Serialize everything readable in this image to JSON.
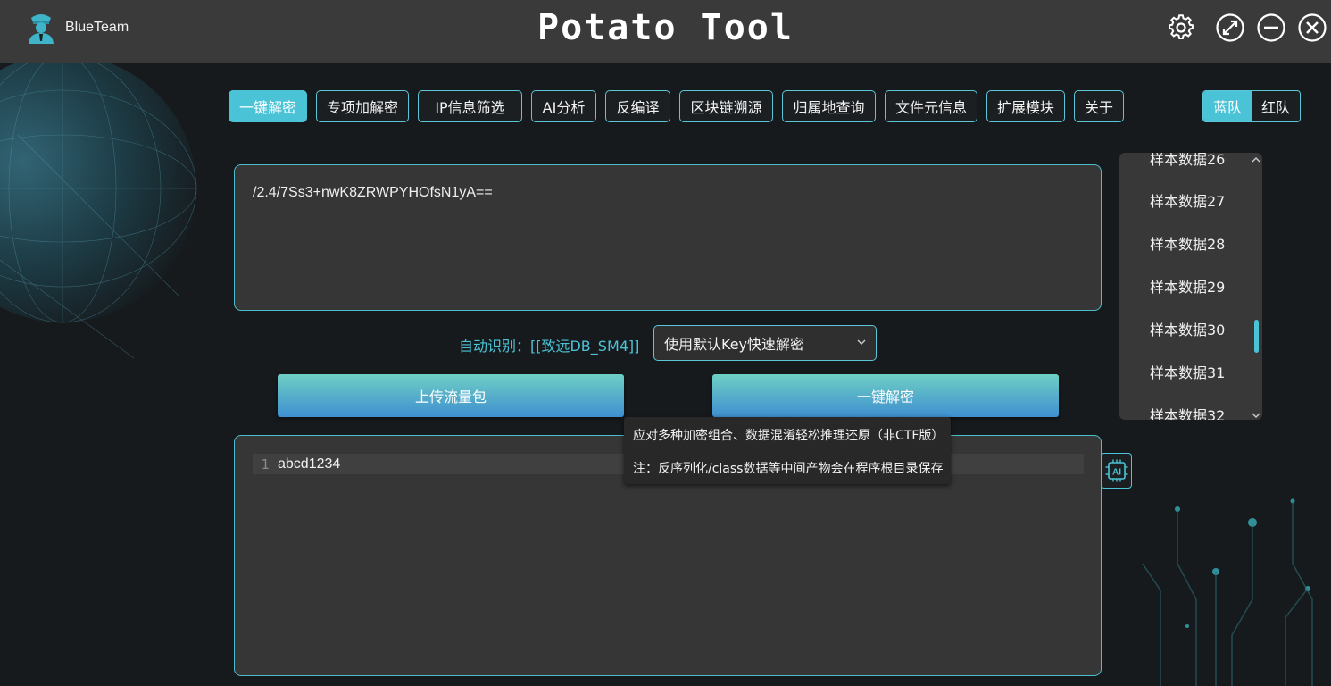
{
  "window": {
    "user_name": "BlueTeam",
    "app_title": "Potato Tool",
    "controls": [
      "gear-icon",
      "maximize-icon",
      "minimize-icon",
      "close-icon"
    ]
  },
  "nav": {
    "items": [
      "一键解密",
      "专项加解密",
      "IP信息筛选",
      "AI分析",
      "反编译",
      "区块链溯源",
      "归属地查询",
      "文件元信息",
      "扩展模块",
      "关于"
    ],
    "active_index": 0
  },
  "team_toggle": {
    "blue": "蓝队",
    "red": "红队",
    "selected": "蓝队"
  },
  "input": {
    "text": "/2.4/7Ss3+nwK8ZRWPYHOfsN1yA=="
  },
  "detect": {
    "label": "自动识别：[[致远DB_SM4]]"
  },
  "mode_select": {
    "value": "使用默认Key快速解密"
  },
  "actions": {
    "upload": "上传流量包",
    "decrypt": "一键解密"
  },
  "samples": {
    "items": [
      "样本数据26",
      "样本数据27",
      "样本数据28",
      "样本数据29",
      "样本数据30",
      "样本数据31",
      "样本数据32"
    ]
  },
  "output": {
    "line_number": "1",
    "text": "abcd1234",
    "ai_button": "AI"
  },
  "tooltip": {
    "line1": "应对多种加密组合、数据混淆轻松推理还原（非CTF版）",
    "line2": "注：反序列化/class数据等中间产物会在程序根目录保存"
  },
  "colors": {
    "accent": "#4bc3d6",
    "button_top": "#6ecfc4",
    "button_bottom": "#3f8fd0",
    "titlebar": "#3a3a3a"
  }
}
